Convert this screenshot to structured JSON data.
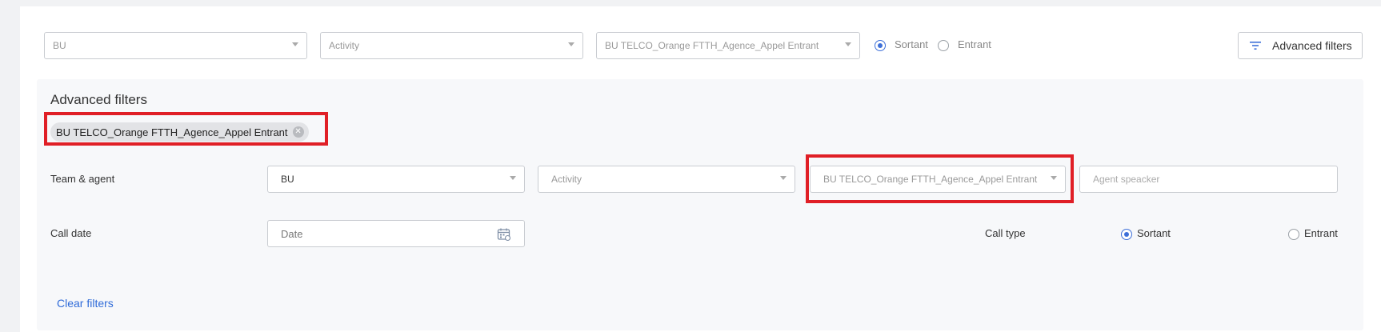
{
  "top_filters": {
    "bu": {
      "placeholder": "BU"
    },
    "activity": {
      "placeholder": "Activity"
    },
    "campaign": {
      "value": "BU TELCO_Orange FTTH_Agence_Appel Entrant"
    },
    "direction": {
      "options": [
        "Sortant",
        "Entrant"
      ],
      "selected": "Sortant"
    },
    "advanced_button": {
      "label": "Advanced filters",
      "icon": "filter-lines-icon"
    }
  },
  "advanced": {
    "title": "Advanced filters",
    "chip": {
      "label": "BU TELCO_Orange FTTH_Agence_Appel Entrant",
      "remove_icon": "circle-x-icon"
    },
    "team_agent": {
      "label": "Team & agent",
      "bu": "BU",
      "activity": {
        "placeholder": "Activity"
      },
      "campaign": {
        "value": "BU TELCO_Orange FTTH_Agence_Appel Entrant"
      },
      "agent": {
        "placeholder": "Agent speacker"
      }
    },
    "call_date": {
      "label": "Call date",
      "placeholder": "Date",
      "icon": "calendar-icon"
    },
    "call_type": {
      "label": "Call type",
      "options": [
        "Sortant",
        "Entrant"
      ],
      "selected": "Sortant"
    },
    "clear_label": "Clear filters"
  },
  "colors": {
    "accent": "#3d6fd8",
    "highlight": "#e01f26",
    "link": "#2f6bd8"
  }
}
